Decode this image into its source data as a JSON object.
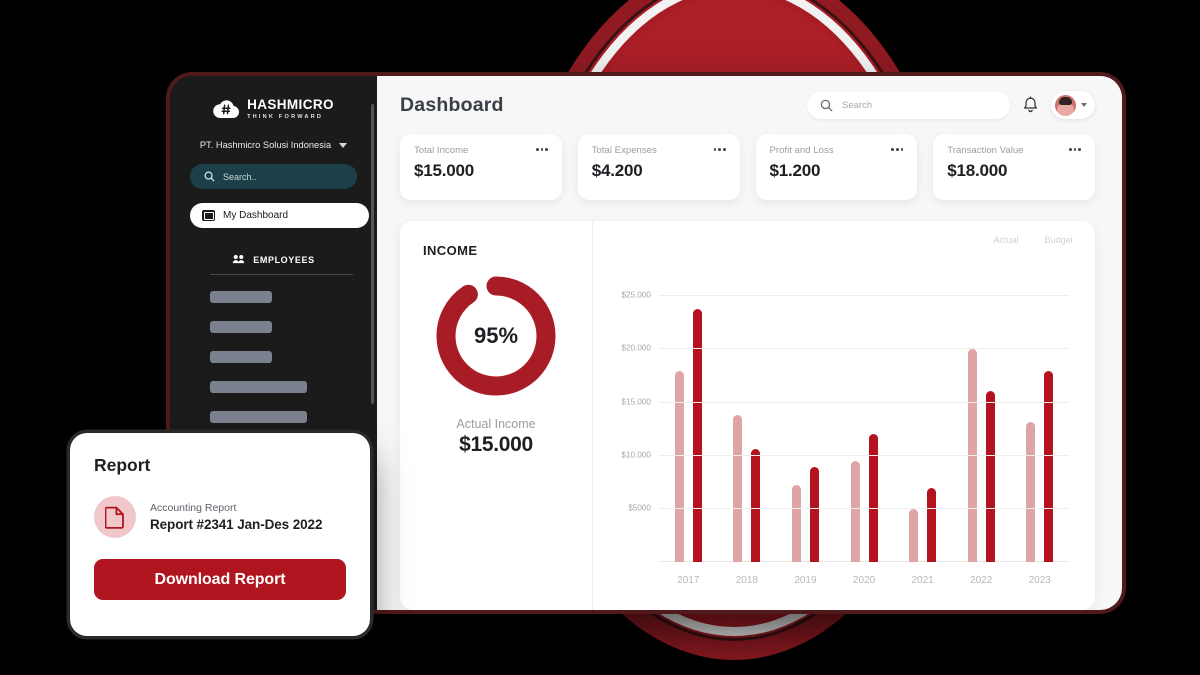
{
  "brand": {
    "logo_name": "HASHMICRO",
    "logo_tagline": "THINK FORWARD",
    "accent_red": "#b0151f",
    "accent_dark_red": "#a81c25",
    "light_pink": "#dea4a6"
  },
  "sidebar": {
    "company": "PT. Hashmicro Solusi Indonesia",
    "search_placeholder": "Search..",
    "nav_active": "My Dashboard",
    "section_label": "EMPLOYEES",
    "skeleton_widths": [
      "62px",
      "62px",
      "62px",
      "97px",
      "97px"
    ]
  },
  "header": {
    "title": "Dashboard",
    "search_placeholder": "Search"
  },
  "kpis": [
    {
      "label": "Total Income",
      "value": "$15.000"
    },
    {
      "label": "Total Expenses",
      "value": "$4.200"
    },
    {
      "label": "Profit and Loss",
      "value": "$1.200"
    },
    {
      "label": "Transaction Value",
      "value": "$18.000"
    }
  ],
  "income_panel": {
    "title": "INCOME",
    "donut_percent_label": "95%",
    "donut_percent": 95,
    "actual_label": "Actual Income",
    "actual_value": "$15.000"
  },
  "report_card": {
    "title": "Report",
    "subtitle": "Accounting Report",
    "name": "Report #2341 Jan-Des 2022",
    "button": "Download Report"
  },
  "chart_data": {
    "type": "bar",
    "title": "INCOME",
    "xlabel": "",
    "ylabel": "",
    "categories": [
      "2017",
      "2018",
      "2019",
      "2020",
      "2021",
      "2022",
      "2023"
    ],
    "series": [
      {
        "name": "Actual",
        "color": "#dea4a6",
        "values": [
          18000,
          13800,
          7200,
          9500,
          5000,
          20000,
          13200
        ]
      },
      {
        "name": "Budget",
        "color": "#b4121f",
        "values": [
          23800,
          10600,
          8900,
          12000,
          7000,
          16100,
          18000
        ]
      }
    ],
    "ylim": [
      0,
      27000
    ],
    "yticks": [
      5000,
      10000,
      15000,
      20000,
      25000
    ],
    "ytick_labels": [
      "$5000",
      "$10.000",
      "$15.000",
      "$20.000",
      "$25.000"
    ],
    "grid": true,
    "legend_position": "top-right"
  }
}
